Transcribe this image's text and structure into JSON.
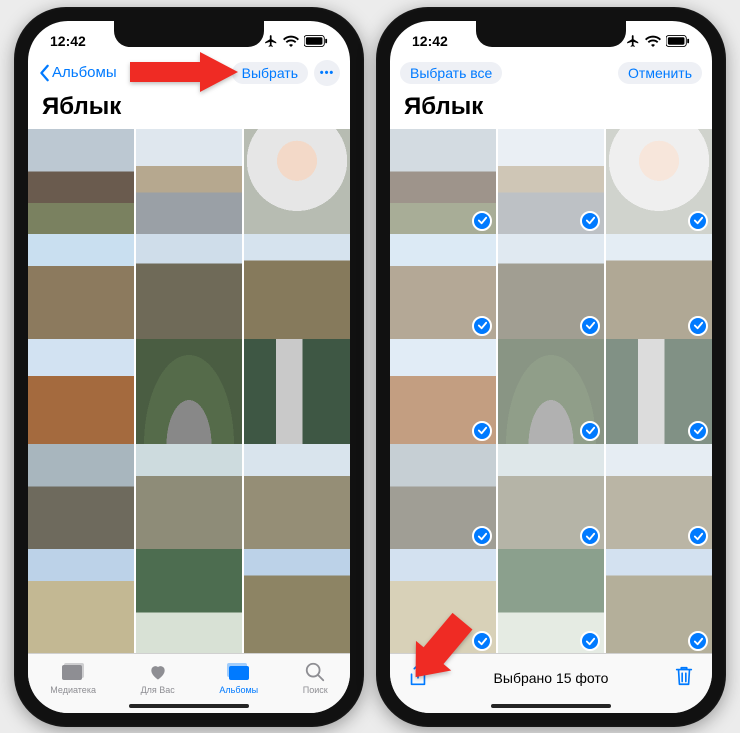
{
  "status": {
    "time": "12:42"
  },
  "left": {
    "back_label": "Альбомы",
    "select_label": "Выбрать",
    "title": "Яблык",
    "tabs": [
      {
        "label": "Медиатека"
      },
      {
        "label": "Для Вас"
      },
      {
        "label": "Альбомы"
      },
      {
        "label": "Поиск"
      }
    ]
  },
  "right": {
    "select_all_label": "Выбрать все",
    "cancel_label": "Отменить",
    "title": "Яблык",
    "selection_status": "Выбрано 15 фото"
  },
  "thumbs": [
    "p-church1",
    "p-church2",
    "p-girl",
    "p-bld1",
    "p-bld2",
    "p-bld3",
    "p-brick",
    "p-road",
    "p-gorge",
    "p-rocks",
    "p-tower",
    "p-mono",
    "p-arch",
    "p-water",
    "p-cols"
  ],
  "colors": {
    "accent": "#007aff",
    "arrow": "#ef2b24"
  }
}
